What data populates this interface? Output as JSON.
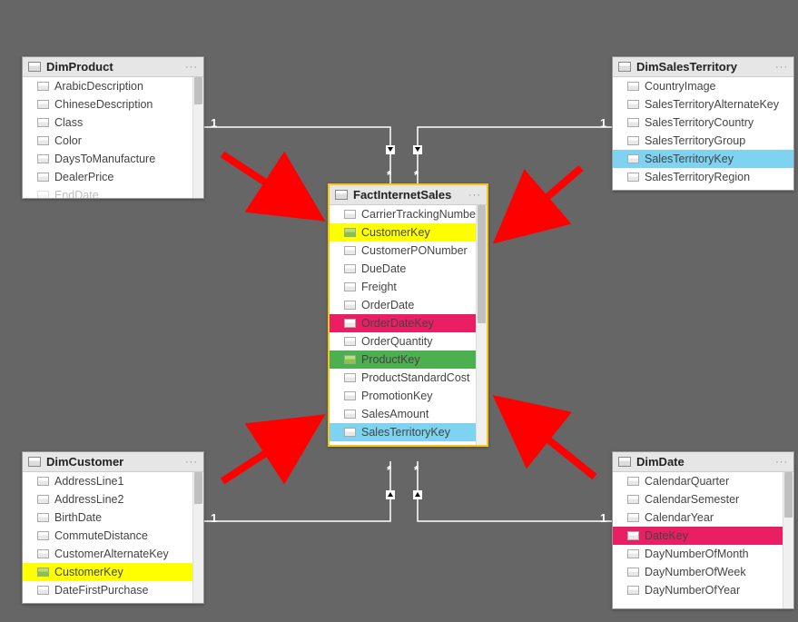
{
  "tables": {
    "dimProduct": {
      "title": "DimProduct",
      "fields": [
        {
          "label": "ArabicDescription"
        },
        {
          "label": "ChineseDescription"
        },
        {
          "label": "Class"
        },
        {
          "label": "Color"
        },
        {
          "label": "DaysToManufacture"
        },
        {
          "label": "DealerPrice"
        },
        {
          "label": "EndDate"
        }
      ]
    },
    "dimSalesTerritory": {
      "title": "DimSalesTerritory",
      "fields": [
        {
          "label": "CountryImage"
        },
        {
          "label": "SalesTerritoryAlternateKey"
        },
        {
          "label": "SalesTerritoryCountry"
        },
        {
          "label": "SalesTerritoryGroup"
        },
        {
          "label": "SalesTerritoryKey",
          "highlight": "cyan"
        },
        {
          "label": "SalesTerritoryRegion"
        }
      ]
    },
    "factInternetSales": {
      "title": "FactInternetSales",
      "fields": [
        {
          "label": "CarrierTrackingNumber"
        },
        {
          "label": "CustomerKey",
          "highlight": "yellow"
        },
        {
          "label": "CustomerPONumber"
        },
        {
          "label": "DueDate"
        },
        {
          "label": "Freight"
        },
        {
          "label": "OrderDate"
        },
        {
          "label": "OrderDateKey",
          "highlight": "red"
        },
        {
          "label": "OrderQuantity"
        },
        {
          "label": "ProductKey",
          "highlight": "green"
        },
        {
          "label": "ProductStandardCost"
        },
        {
          "label": "PromotionKey"
        },
        {
          "label": "SalesAmount"
        },
        {
          "label": "SalesTerritoryKey",
          "highlight": "cyan"
        }
      ]
    },
    "dimCustomer": {
      "title": "DimCustomer",
      "fields": [
        {
          "label": "AddressLine1"
        },
        {
          "label": "AddressLine2"
        },
        {
          "label": "BirthDate"
        },
        {
          "label": "CommuteDistance"
        },
        {
          "label": "CustomerAlternateKey"
        },
        {
          "label": "CustomerKey",
          "highlight": "yellow"
        },
        {
          "label": "DateFirstPurchase"
        }
      ]
    },
    "dimDate": {
      "title": "DimDate",
      "fields": [
        {
          "label": "CalendarQuarter"
        },
        {
          "label": "CalendarSemester"
        },
        {
          "label": "CalendarYear"
        },
        {
          "label": "DateKey",
          "highlight": "red"
        },
        {
          "label": "DayNumberOfMonth"
        },
        {
          "label": "DayNumberOfWeek"
        },
        {
          "label": "DayNumberOfYear"
        }
      ]
    }
  },
  "cardinality": {
    "one": "1",
    "many": "*"
  },
  "menu": "···"
}
